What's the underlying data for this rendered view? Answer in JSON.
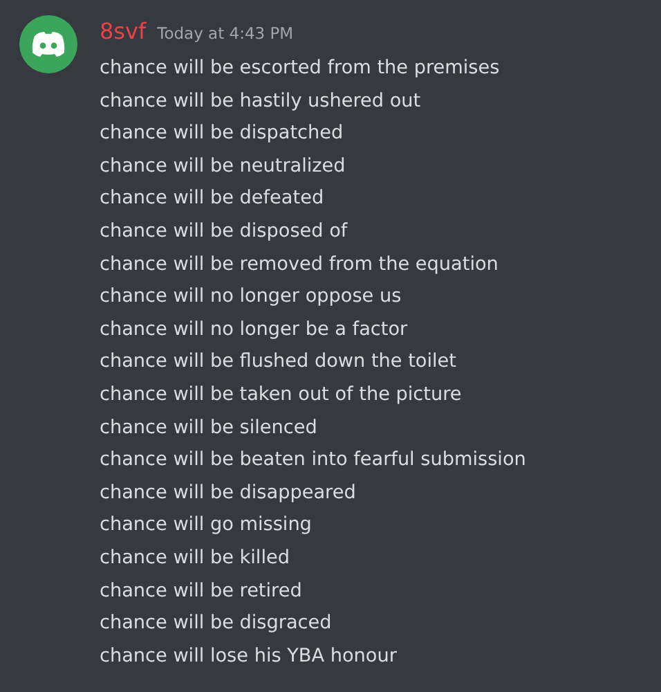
{
  "message": {
    "author": "8svf",
    "timestamp": "Today at 4:43 PM",
    "lines": [
      "chance will be escorted from the premises",
      "chance will be hastily ushered out",
      "chance will be dispatched",
      "chance will be neutralized",
      "chance will be defeated",
      "chance will be disposed of",
      "chance will be removed from the equation",
      "chance will no longer oppose us",
      "chance will no longer be a factor",
      "chance will be flushed down the toilet",
      "chance will be taken out of the picture",
      "chance will be silenced",
      "chance will be beaten into fearful submission",
      "chance will be disappeared",
      "chance will go missing",
      "chance will be killed",
      "chance will be retired",
      "chance will be disgraced",
      "chance will lose his YBA honour"
    ]
  }
}
